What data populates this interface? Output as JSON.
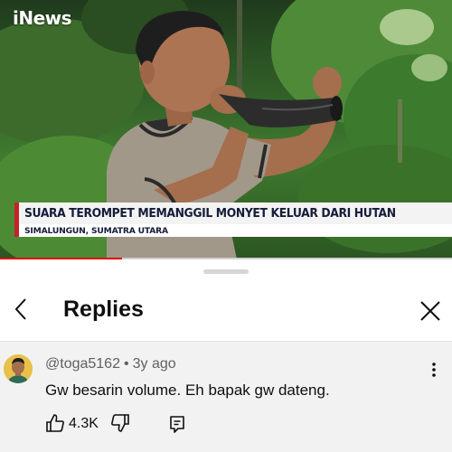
{
  "video": {
    "channel_logo": "iNews",
    "headline": "SUARA TEROMPET MEMANGGIL MONYET KELUAR DARI HUTAN",
    "location": "SIMALUNGUN, SUMATRA UTARA",
    "progress_fraction": 0.27,
    "colors": {
      "accent_red": "#c8202a",
      "headline_text": "#151c3a",
      "progress": "#e10000"
    }
  },
  "panel": {
    "title": "Replies",
    "back_icon": "chevron-left-icon",
    "close_icon": "close-icon"
  },
  "comment": {
    "author": "@toga5162",
    "separator": "•",
    "age": "3y ago",
    "text": "Gw besarin volume. Eh bapak gw dateng.",
    "like_count": "4.3K",
    "icons": [
      "like-icon",
      "dislike-icon",
      "reply-icon",
      "more-vert-icon"
    ]
  }
}
